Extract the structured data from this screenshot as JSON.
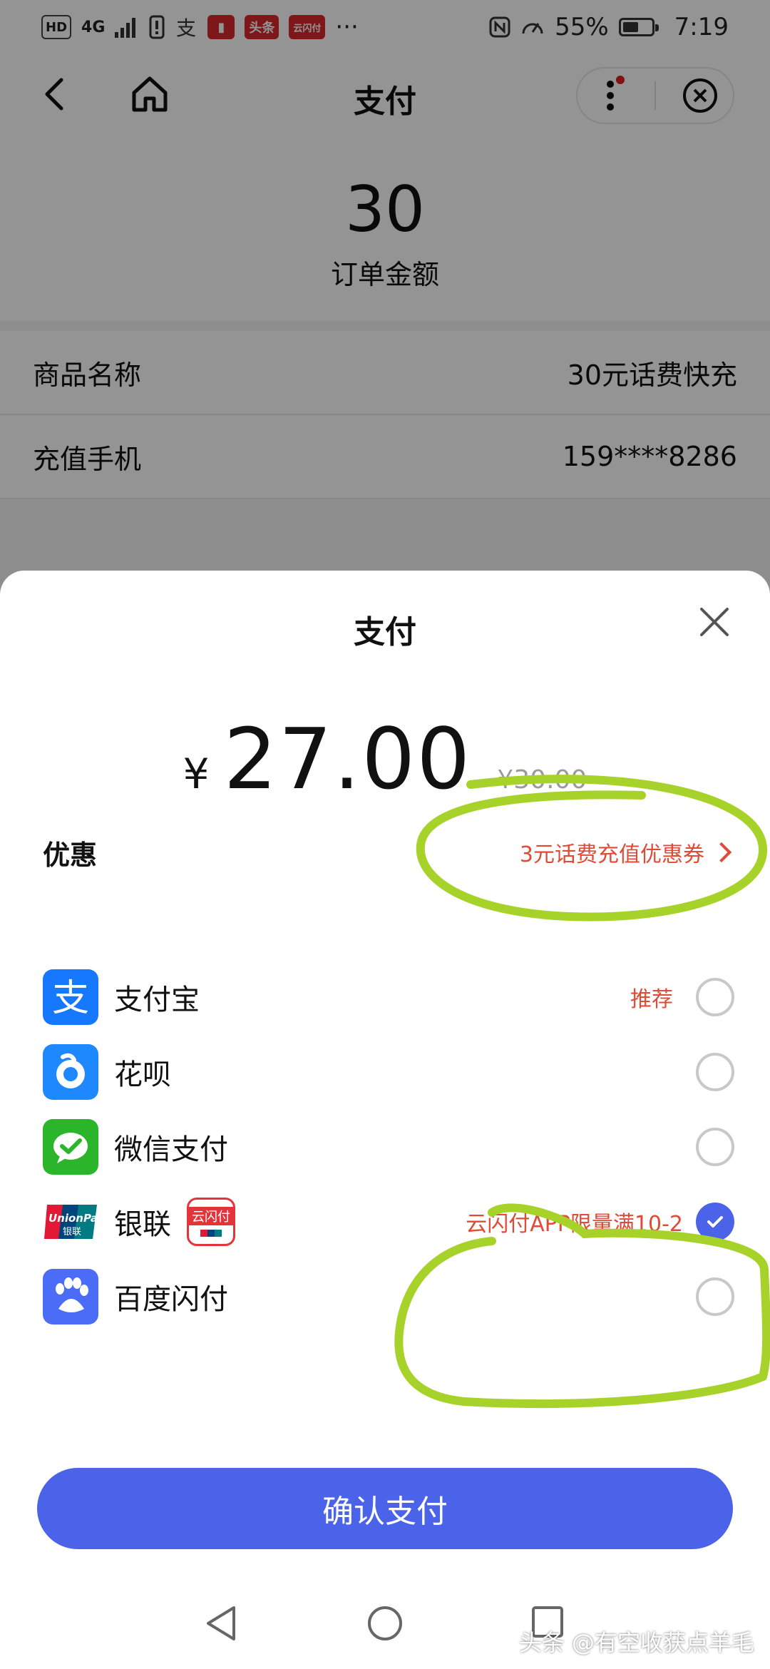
{
  "status_bar": {
    "network_hd": "HD",
    "network_4g": "4G",
    "app_icon_news": "头条",
    "app_icon_ysf": "云闪付",
    "more_dots": "···",
    "battery_percent": "55%",
    "battery_level": 0.55,
    "time": "7:19"
  },
  "nav": {
    "title": "支付"
  },
  "order": {
    "amount": "30",
    "amount_caption": "订单金额",
    "rows": [
      {
        "label": "商品名称",
        "value": "30元话费快充"
      },
      {
        "label": "充值手机",
        "value": "159****8286"
      }
    ]
  },
  "sheet": {
    "title": "支付",
    "currency": "¥",
    "price": "27.00",
    "original_price": "¥30.00",
    "discount_label": "优惠",
    "discount_value": "3元话费充值优惠券",
    "methods": [
      {
        "label": "支付宝",
        "tag": "推荐",
        "selected": false,
        "icon": "alipay-icon"
      },
      {
        "label": "花呗",
        "tag": "",
        "selected": false,
        "icon": "huabei-icon"
      },
      {
        "label": "微信支付",
        "tag": "",
        "selected": false,
        "icon": "wechat-pay-icon"
      },
      {
        "label": "银联",
        "tag": "云闪付APP限量满10-2",
        "selected": true,
        "icon": "unionpay-icon"
      },
      {
        "label": "百度闪付",
        "tag": "",
        "selected": false,
        "icon": "baidu-pay-icon"
      }
    ],
    "unionpay_logo_text": "UnionPay",
    "unionpay_logo_sub": "银联",
    "ysf_logo_text": "云闪付",
    "confirm_label": "确认支付"
  },
  "watermark": "头条 @有空收获点羊毛",
  "colors": {
    "accent": "#4a63e8",
    "promo_red": "#e14a35",
    "annotation_green": "#a6d22a"
  }
}
